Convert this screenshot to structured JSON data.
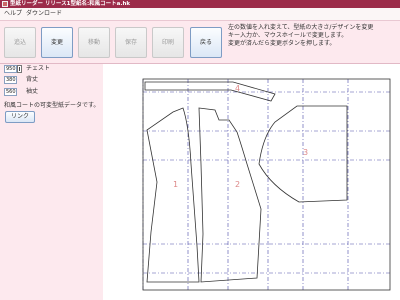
{
  "window": {
    "title": "型紙リーダー リリース1型紙名:和風コートa.hk"
  },
  "menu": {
    "items": [
      "ヘルプ",
      "ダウンロード"
    ]
  },
  "toolbar": {
    "buttons": [
      {
        "label": "追込",
        "enabled": false
      },
      {
        "label": "変更",
        "enabled": true
      },
      {
        "label": "移動",
        "enabled": false
      },
      {
        "label": "保存",
        "enabled": false
      },
      {
        "label": "印刷",
        "enabled": false
      },
      {
        "label": "戻る",
        "enabled": true
      }
    ],
    "info_lines": [
      "左の数値を入れ変えて、型紙の大きさ/デザインを変更",
      "キー入力か、マウスホイールで変更します。",
      "変更が済んだら変更ボタンを押します。"
    ]
  },
  "fields": [
    {
      "value": "950",
      "label": "チェスト"
    },
    {
      "value": "380",
      "label": "背丈"
    },
    {
      "value": "560",
      "label": "袖丈"
    }
  ],
  "note": "和風コートの可変型紙データです。",
  "link_label": "リンク",
  "pattern": {
    "piece_labels": [
      "1",
      "2",
      "3",
      "4"
    ]
  }
}
